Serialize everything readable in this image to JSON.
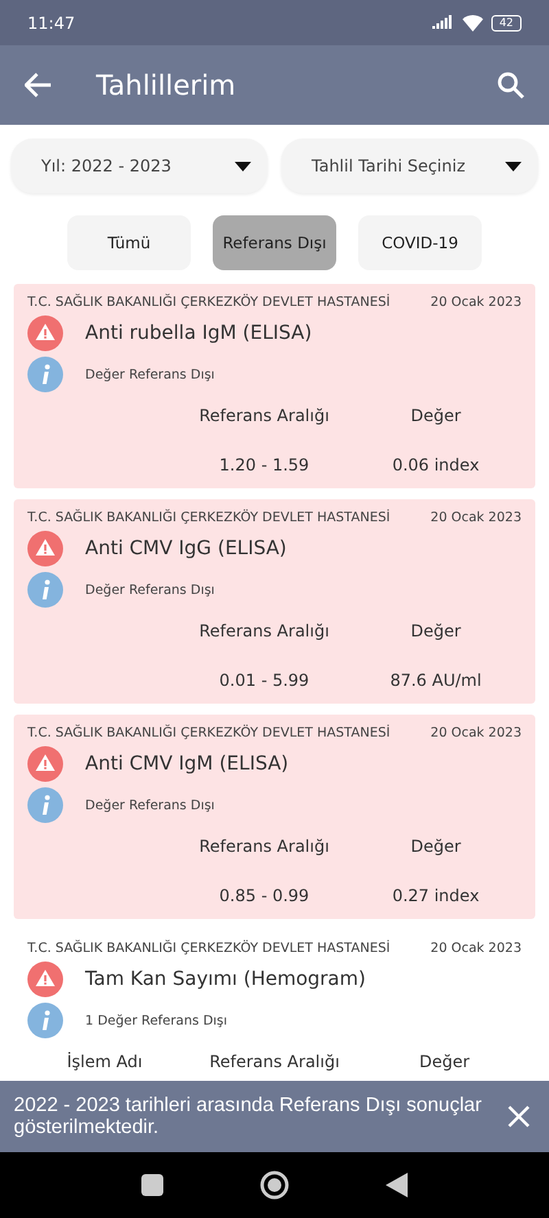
{
  "status_bar": {
    "time": "11:47",
    "battery": "42"
  },
  "app_bar": {
    "title": "Tahlillerim"
  },
  "filters": [
    {
      "label": "Yıl: 2022 - 2023"
    },
    {
      "label": "Tahlil Tarihi Seçiniz"
    }
  ],
  "tabs": [
    {
      "label": "Tümü",
      "selected": false
    },
    {
      "label": "Referans Dışı",
      "selected": true
    },
    {
      "label": "COVID-19",
      "selected": false
    }
  ],
  "results": [
    {
      "hospital": "T.C. SAĞLIK BAKANLIĞI ÇERKEZKÖY DEVLET HASTANESİ",
      "date": "20 Ocak 2023",
      "test": "Anti rubella IgM (ELISA)",
      "note": "Değer Referans Dışı",
      "highlighted": true,
      "columns": [
        "Referans Aralığı",
        "Değer"
      ],
      "values": [
        "1.20 - 1.59",
        "0.06 index"
      ]
    },
    {
      "hospital": "T.C. SAĞLIK BAKANLIĞI ÇERKEZKÖY DEVLET HASTANESİ",
      "date": "20 Ocak 2023",
      "test": "Anti CMV IgG (ELISA)",
      "note": "Değer Referans Dışı",
      "highlighted": true,
      "columns": [
        "Referans Aralığı",
        "Değer"
      ],
      "values": [
        "0.01 - 5.99",
        "87.6 AU/ml"
      ]
    },
    {
      "hospital": "T.C. SAĞLIK BAKANLIĞI ÇERKEZKÖY DEVLET HASTANESİ",
      "date": "20 Ocak 2023",
      "test": "Anti CMV IgM (ELISA)",
      "note": "Değer Referans Dışı",
      "highlighted": true,
      "columns": [
        "Referans Aralığı",
        "Değer"
      ],
      "values": [
        "0.85 - 0.99",
        "0.27 index"
      ]
    },
    {
      "hospital": "T.C. SAĞLIK BAKANLIĞI ÇERKEZKÖY DEVLET HASTANESİ",
      "date": "20 Ocak 2023",
      "test": "Tam Kan Sayımı (Hemogram)",
      "note": "1 Değer Referans Dışı",
      "highlighted": false,
      "columns": [
        "İşlem Adı",
        "Referans Aralığı",
        "Değer"
      ]
    }
  ],
  "snackbar": {
    "message": "2022 - 2023 tarihleri arasında Referans Dışı sonuçlar gösterilmektedir."
  }
}
